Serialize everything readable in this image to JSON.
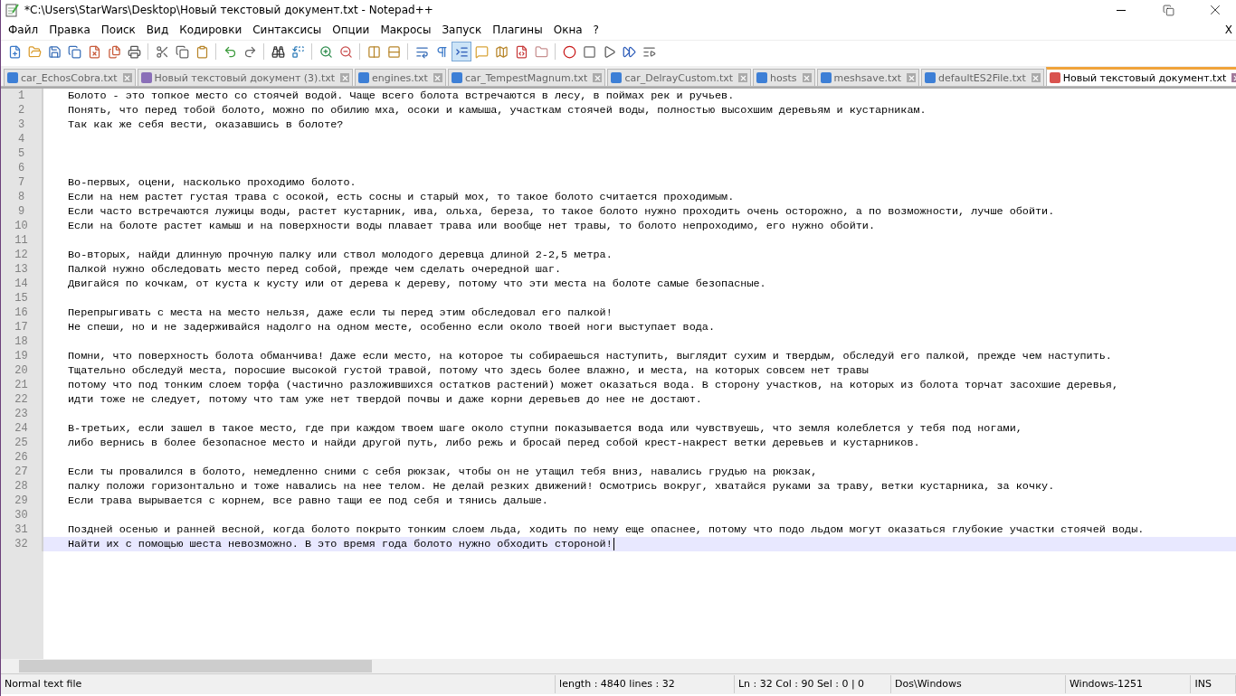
{
  "window": {
    "title": "*C:\\Users\\StarWars\\Desktop\\Новый текстовый документ.txt - Notepad++"
  },
  "menu": [
    "Файл",
    "Правка",
    "Поиск",
    "Вид",
    "Кодировки",
    "Синтаксисы",
    "Опции",
    "Макросы",
    "Запуск",
    "Плагины",
    "Окна",
    "?"
  ],
  "close_document": "X",
  "toolbar": [
    [
      {
        "pressed": false
      },
      {
        "pressed": false
      },
      {
        "pressed": false
      },
      {
        "pressed": false
      },
      {
        "pressed": false
      },
      {
        "pressed": false
      },
      {
        "pressed": false
      }
    ],
    [
      {
        "pressed": false
      },
      {
        "pressed": false
      },
      {
        "pressed": false
      }
    ],
    [
      {
        "pressed": false
      },
      {
        "pressed": false
      }
    ],
    [
      {
        "pressed": false
      },
      {
        "pressed": false
      }
    ],
    [
      {
        "pressed": false
      },
      {
        "pressed": false
      }
    ],
    [
      {
        "pressed": false
      },
      {
        "pressed": false
      }
    ],
    [
      {
        "pressed": false
      },
      {
        "pressed": false
      },
      {
        "pressed": true
      },
      {
        "pressed": false
      },
      {
        "pressed": false
      },
      {
        "pressed": false
      },
      {
        "pressed": false
      }
    ],
    [
      {
        "pressed": false
      },
      {
        "pressed": false
      },
      {
        "pressed": false
      },
      {
        "pressed": false
      },
      {
        "pressed": false
      }
    ]
  ],
  "tabs": [
    {
      "label": "car_EchosCobra.txt",
      "selected": false,
      "color": "#3d7fd6"
    },
    {
      "label": "Новый текстовый документ (3).txt",
      "selected": false,
      "color": "#8a6fb8"
    },
    {
      "label": "engines.txt",
      "selected": false,
      "color": "#3d7fd6"
    },
    {
      "label": "car_TempestMagnum.txt",
      "selected": false,
      "color": "#3d7fd6"
    },
    {
      "label": "car_DelrayCustom.txt",
      "selected": false,
      "color": "#3d7fd6"
    },
    {
      "label": "hosts",
      "selected": false,
      "color": "#3d7fd6"
    },
    {
      "label": "meshsave.txt",
      "selected": false,
      "color": "#3d7fd6"
    },
    {
      "label": "defaultES2File.txt",
      "selected": false,
      "color": "#3d7fd6"
    },
    {
      "label": "Новый текстовый документ.txt",
      "selected": true,
      "color": "#d9534f"
    }
  ],
  "editor": {
    "lines": [
      {
        "number": "1",
        "text": "Болото - это топкое место со стоячей водой. Чаще всего болота встречаются в лесу, в поймах рек и ручьев.",
        "current": false
      },
      {
        "number": "2",
        "text": "Понять, что перед тобой болото, можно по обилию мха, осоки и камыша, участкам стоячей воды, полностью высохшим деревьям и кустарникам.",
        "current": false
      },
      {
        "number": "3",
        "text": "Так как же себя вести, оказавшись в болоте?",
        "current": false
      },
      {
        "number": "4",
        "current": false
      },
      {
        "number": "5",
        "current": false
      },
      {
        "number": "6",
        "current": false
      },
      {
        "number": "7",
        "text": "Во-первых, оцени, насколько проходимо болото.",
        "current": false
      },
      {
        "number": "8",
        "text": "Если на нем растет густая трава с осокой, есть сосны и старый мох, то такое болото считается проходимым.",
        "current": false
      },
      {
        "number": "9",
        "text": "Если часто встречаются лужицы воды, растет кустарник, ива, ольха, береза, то такое болото нужно проходить очень осторожно, а по возможности, лучше обойти.",
        "current": false
      },
      {
        "number": "10",
        "text": "Если на болоте растет камыш и на поверхности воды плавает трава или вообще нет травы, то болото непроходимо, его нужно обойти.",
        "current": false
      },
      {
        "number": "11",
        "current": false
      },
      {
        "number": "12",
        "text": "Во-вторых, найди длинную прочную палку или ствол молодого деревца длиной 2-2,5 метра.",
        "current": false
      },
      {
        "number": "13",
        "text": "Палкой нужно обследовать место перед собой, прежде чем сделать очередной шаг.",
        "current": false
      },
      {
        "number": "14",
        "text": "Двигайся по кочкам, от куста к кусту или от дерева к дереву, потому что эти места на болоте самые безопасные.",
        "current": false
      },
      {
        "number": "15",
        "current": false
      },
      {
        "number": "16",
        "text": "Перепрыгивать с места на место нельзя, даже если ты перед этим обследовал его палкой!",
        "current": false
      },
      {
        "number": "17",
        "text": "Не спеши, но и не задерживайся надолго на одном месте, особенно если около твоей ноги выступает вода.",
        "current": false
      },
      {
        "number": "18",
        "current": false
      },
      {
        "number": "19",
        "text": "Помни, что поверхность болота обманчива! Даже если место, на которое ты собираешься наступить, выглядит сухим и твердым, обследуй его палкой, прежде чем наступить.",
        "current": false
      },
      {
        "number": "20",
        "text": "Тщательно обследуй места, поросшие высокой густой травой, потому что здесь более влажно, и места, на которых совсем нет травы",
        "current": false
      },
      {
        "number": "21",
        "text": "потому что под тонким слоем торфа (частично разложившихся остатков растений) может оказаться вода. В сторону участков, на которых из болота торчат засохшие деревья,",
        "current": false
      },
      {
        "number": "22",
        "text": "идти тоже не следует, потому что там уже нет твердой почвы и даже корни деревьев до нее не достают.",
        "current": false
      },
      {
        "number": "23",
        "current": false
      },
      {
        "number": "24",
        "text": "В-третьих, если зашел в такое место, где при каждом твоем шаге около ступни показывается вода или чувствуешь, что земля колеблется у тебя под ногами,",
        "current": false
      },
      {
        "number": "25",
        "text": "либо вернись в более безопасное место и найди другой путь, либо режь и бросай перед собой крест-накрест ветки деревьев и кустарников.",
        "current": false
      },
      {
        "number": "26",
        "current": false
      },
      {
        "number": "27",
        "text": "Если ты провалился в болото, немедленно сними с себя рюкзак, чтобы он не утащил тебя вниз, навались грудью на рюкзак,",
        "current": false
      },
      {
        "number": "28",
        "text": "палку положи горизонтально и тоже навались на нее телом. Не делай резких движений! Осмотрись вокруг, хватайся руками за траву, ветки кустарника, за кочку.",
        "current": false
      },
      {
        "number": "29",
        "text": "Если трава вырывается с корнем, все равно тащи ее под себя и тянись дальше.",
        "current": false
      },
      {
        "number": "30",
        "current": false
      },
      {
        "number": "31",
        "text": "Поздней осенью и ранней весной, когда болото покрыто тонким слоем льда, ходить по нему еще опаснее, потому что подо льдом могут оказаться глубокие участки стоячей воды.",
        "current": false
      },
      {
        "number": "32",
        "text": "Найти их с помощью шеста невозможно. В это время года болото нужно обходить стороной!",
        "current": true
      }
    ]
  },
  "status_bar": [
    {
      "kind": "wide",
      "text": "Normal text file"
    },
    {
      "kind": "mid",
      "text": "length : 4840    lines : 32"
    },
    {
      "kind": "mid",
      "text": "Ln : 32    Col : 90    Sel : 0 | 0"
    },
    {
      "kind": "mid",
      "text": "Dos\\Windows"
    },
    {
      "kind": "narrow",
      "text": "Windows-1251"
    },
    {
      "kind": "end",
      "text": "INS"
    }
  ]
}
